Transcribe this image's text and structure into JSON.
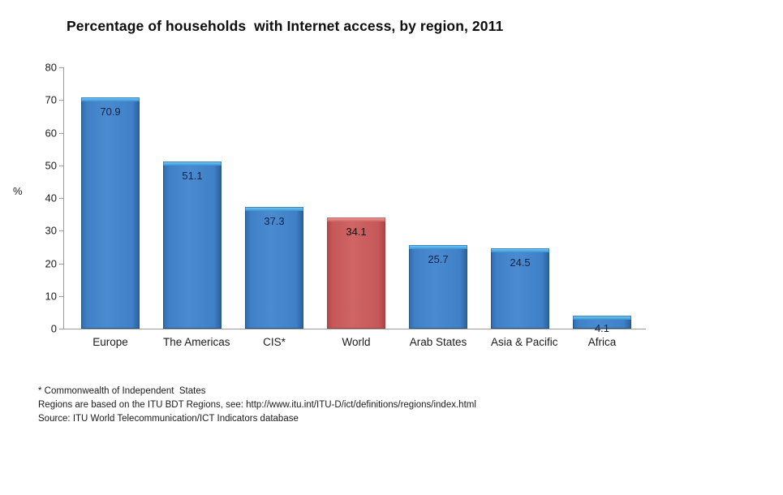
{
  "chart_data": {
    "type": "bar",
    "title": "Percentage of households  with Internet access, by region, 2011",
    "xlabel": "",
    "ylabel": "%",
    "ylim": [
      0,
      80
    ],
    "ytick_step": 10,
    "yticks": [
      "80",
      "70",
      "60",
      "50",
      "40",
      "30",
      "20",
      "10",
      "0"
    ],
    "grid": false,
    "legend": null,
    "categories": [
      "Europe",
      "The Americas",
      "CIS*",
      "World",
      "Arab States",
      "Asia & Pacific",
      "Africa"
    ],
    "values": [
      70.9,
      51.1,
      37.3,
      34.1,
      25.7,
      24.5,
      4.1
    ],
    "value_labels": [
      "70.9",
      "51.1",
      "37.3",
      "34.1",
      "25.7",
      "24.5",
      "4.1"
    ],
    "bar_colors": [
      "#3f80c6",
      "#3f80c6",
      "#3f80c6",
      "#c6585a",
      "#3f80c6",
      "#3f80c6",
      "#3f80c6"
    ],
    "highlight_category": "World",
    "series_color_primary": "#3f80c6",
    "series_color_highlight": "#c6585a",
    "annotations": [
      "* Commonwealth of Independent  States",
      "Regions are based on the ITU BDT Regions, see: http://www.itu.int/ITU-D/ict/definitions/regions/index.html",
      "Source: ITU World Telecommunication/ICT Indicators database"
    ]
  },
  "footnotes": {
    "line1": "* Commonwealth of Independent  States",
    "line2": "Regions are based on the ITU BDT Regions, see: http://www.itu.int/ITU-D/ict/definitions/regions/index.html",
    "line3": "Source: ITU World Telecommunication/ICT Indicators database"
  }
}
